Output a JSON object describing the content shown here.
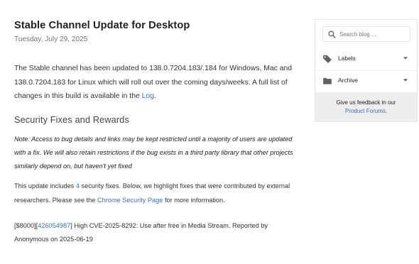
{
  "post": {
    "title": "Stable Channel Update for Desktop",
    "date": "Tuesday, July 29, 2025",
    "intro_before": "The Stable channel has been updated to 138.0.7204.183/.184 for Windows, Mac and 138.0.7204.183 for Linux which will roll out over the coming days/weeks. A full list of changes in this build is available in the ",
    "intro_link": "Log",
    "intro_after": ".",
    "section_heading": "Security Fixes and Rewards",
    "note": "Note: Access to bug details and links may be kept restricted until a majority of users are updated with a fix. We will also retain restrictions if the bug exists in a third party library that other projects similarly depend on, but haven't yet fixed",
    "update_before": "This update includes ",
    "update_count_link": "4",
    "update_middle": " security fixes. Below, we highlight fixes that were contributed by external researchers. Please see the ",
    "update_page_link": "Chrome Security Page",
    "update_after": " for more information.",
    "fix_prefix": "[$8000][",
    "fix_bug_link": "426054987",
    "fix_text": "] High CVE-2025-8292: Use after free in Media Stream. Reported by Anonymous on 2025-06-19"
  },
  "sidebar": {
    "search_placeholder": "Search blog ...",
    "labels": "Labels",
    "archive": "Archive",
    "feedback_text": "Give us feedback in our",
    "feedback_link": "Product Forums",
    "feedback_after": "."
  },
  "colors": {
    "link": "#3c6fb7",
    "icon": "#616161"
  }
}
